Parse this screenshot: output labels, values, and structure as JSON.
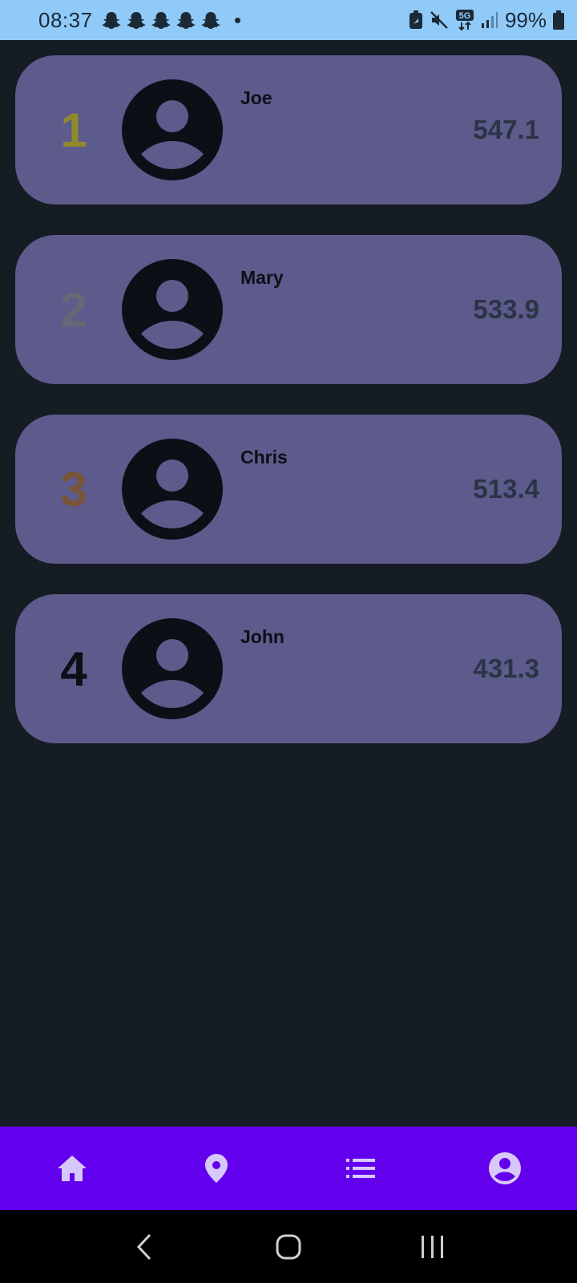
{
  "status_bar": {
    "time": "08:37",
    "battery": "99%",
    "network": "5G",
    "notification_icons": [
      "snapchat-icon",
      "snapchat-icon",
      "snapchat-icon",
      "snapchat-icon",
      "snapchat-icon"
    ]
  },
  "leaderboard": [
    {
      "rank": "1",
      "name": "Joe",
      "score": "547.1",
      "rank_color": "#8f8a2c"
    },
    {
      "rank": "2",
      "name": "Mary",
      "score": "533.9",
      "rank_color": "#676875"
    },
    {
      "rank": "3",
      "name": "Chris",
      "score": "513.4",
      "rank_color": "#7a5438"
    },
    {
      "rank": "4",
      "name": "John",
      "score": "431.3",
      "rank_color": "#0b0f16"
    }
  ],
  "bottom_nav": {
    "items": [
      "home-icon",
      "location-icon",
      "list-icon",
      "account-icon"
    ],
    "background": "#6200ee",
    "icon_color": "#d7c8fb"
  },
  "colors": {
    "background": "#151c24",
    "card": "#5c5b8c",
    "status_bar": "#90caf9"
  }
}
